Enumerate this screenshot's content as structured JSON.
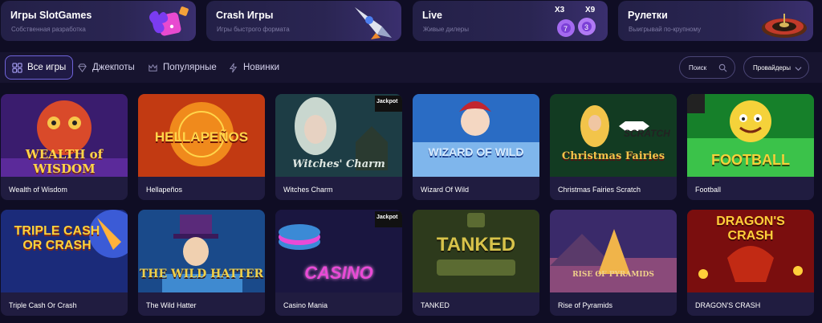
{
  "categories": [
    {
      "title": "Игры SlotGames",
      "subtitle": "Собственная разработка",
      "icon": "clover-dice-icon"
    },
    {
      "title": "Crash Игры",
      "subtitle": "Игры быстрого формата",
      "icon": "rocket-icon"
    },
    {
      "title": "Live",
      "subtitle": "Живые дилеры",
      "icon": "multiplier-balls-icon",
      "badges": [
        "X3",
        "X9"
      ],
      "balls": [
        "7",
        "3"
      ]
    },
    {
      "title": "Рулетки",
      "subtitle": "Выигрывай по-крупному",
      "icon": "roulette-wheel-icon"
    }
  ],
  "filters": {
    "tabs": [
      {
        "label": "Все игры",
        "icon": "grid-icon",
        "active": true
      },
      {
        "label": "Джекпоты",
        "icon": "diamond-icon",
        "active": false
      },
      {
        "label": "Популярные",
        "icon": "crown-icon",
        "active": false
      },
      {
        "label": "Новинки",
        "icon": "lightning-icon",
        "active": false
      }
    ],
    "search_placeholder": "Поиск",
    "providers_label": "Провайдеры"
  },
  "games": [
    {
      "name": "Wealth of Wisdom",
      "art_title": "WEALTH of WISDOM",
      "colors": [
        "#3a1c6e",
        "#d94a2a",
        "#f6c64a"
      ]
    },
    {
      "name": "Hellapeños",
      "art_title": "HELLAPEÑOS",
      "colors": [
        "#c23a12",
        "#f08a1c",
        "#ffd54a"
      ]
    },
    {
      "name": "Witches Charm",
      "art_title": "Witches' Charm",
      "badge": "Jackpot",
      "colors": [
        "#1d3d45",
        "#6f8f8a",
        "#c9d7cf"
      ]
    },
    {
      "name": "Wizard Of Wild",
      "art_title": "WIZARD OF WILD",
      "colors": [
        "#2a6cc4",
        "#7fb6ec",
        "#d8ecff"
      ]
    },
    {
      "name": "Christmas Fairies Scratch",
      "art_title": "Christmas Fairies",
      "badge": "SCRATCH",
      "colors": [
        "#123b22",
        "#2f7a3a",
        "#f2c44a"
      ]
    },
    {
      "name": "Football",
      "art_title": "FOOTBALL",
      "colors": [
        "#16802a",
        "#3bc24a",
        "#f5d23a"
      ]
    },
    {
      "name": "Triple Cash Or Crash",
      "art_title": "TRIPLE CASH OR CRASH",
      "colors": [
        "#1b2b7a",
        "#3b5bd6",
        "#ffd23a"
      ]
    },
    {
      "name": "The Wild Hatter",
      "art_title": "THE WILD HATTER",
      "colors": [
        "#1a4a8a",
        "#3f8ad0",
        "#f0d04a"
      ]
    },
    {
      "name": "Casino Mania",
      "art_title": "CASINO",
      "badge": "Jackpot",
      "colors": [
        "#1a1640",
        "#5a2a8a",
        "#e94ad6"
      ]
    },
    {
      "name": "TANKED",
      "art_title": "TANKED",
      "colors": [
        "#2d3a1c",
        "#5b6b32",
        "#d8c34a"
      ]
    },
    {
      "name": "Rise of Pyramids",
      "art_title": "RISE OF PYRAMIDS",
      "colors": [
        "#3a2a6a",
        "#8a4a7a",
        "#f0b44a"
      ]
    },
    {
      "name": "DRAGON'S CRASH",
      "art_title": "DRAGON'S CRASH",
      "colors": [
        "#7a0e0e",
        "#c22a14",
        "#ffcf3a"
      ]
    }
  ]
}
